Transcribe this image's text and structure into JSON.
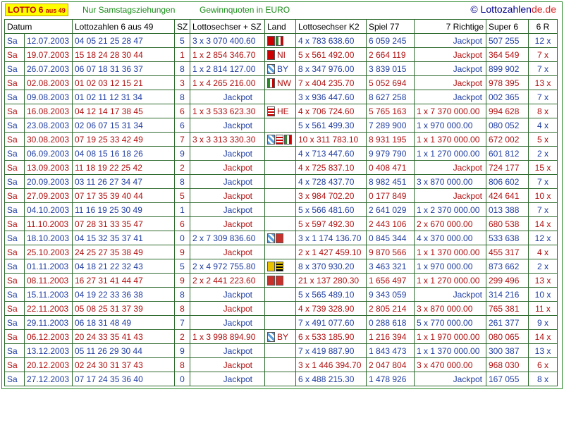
{
  "header": {
    "logo_main": "LOTTO 6",
    "logo_small": "aus 49",
    "subtitle": "Nur Samstagsziehungen",
    "currency_note": "Gewinnquoten in EURO",
    "site_prefix": "© Lottozahlen",
    "site_suffix": "de.de"
  },
  "columns": {
    "datum": "Datum",
    "zahlen": "Lottozahlen 6 aus 49",
    "sz": "SZ",
    "ls": "Lottosechser + SZ",
    "land": "Land",
    "k2": "Lottosechser K2",
    "sp77": "Spiel 77",
    "sr": "7 Richtige",
    "s6": "Super 6",
    "r6": "6 R"
  },
  "rows": [
    {
      "day": "Sa",
      "date": "12.07.2003",
      "nums": "04  05  21  25  28  47",
      "sz": "5",
      "ls": "3 x   3 070 400.60",
      "land": [
        "ni",
        "nw"
      ],
      "land_code": "",
      "k2": "4 x     783 638.60",
      "sp77": "6 059 245",
      "sr": "Jackpot",
      "s6": "507 255",
      "r6": "12 x"
    },
    {
      "day": "Sa",
      "date": "19.07.2003",
      "nums": "15  18  24  28  30  44",
      "sz": "1",
      "ls": "1 x   2 854 346.70",
      "land": [
        "ni"
      ],
      "land_code": "NI",
      "k2": "5 x     561 492.00",
      "sp77": "2 664 119",
      "sr": "Jackpot",
      "s6": "364 549",
      "r6": "7 x"
    },
    {
      "day": "Sa",
      "date": "26.07.2003",
      "nums": "06  07  18  31  36  37",
      "sz": "8",
      "ls": "1 x   2 814 127.00",
      "land": [
        "by"
      ],
      "land_code": "BY",
      "k2": "8 x     347 976.00",
      "sp77": "3 839 015",
      "sr": "Jackpot",
      "s6": "899 902",
      "r6": "7 x"
    },
    {
      "day": "Sa",
      "date": "02.08.2003",
      "nums": "01  02  03  12  15  21",
      "sz": "3",
      "ls": "1 x   4 265 216.00",
      "land": [
        "nw"
      ],
      "land_code": "NW",
      "k2": "7 x     404 235.70",
      "sp77": "5 052 694",
      "sr": "Jackpot",
      "s6": "978 395",
      "r6": "13 x"
    },
    {
      "day": "Sa",
      "date": "09.08.2003",
      "nums": "01  02  11  12  31  34",
      "sz": "8",
      "ls": "Jackpot",
      "land": [],
      "land_code": "",
      "k2": "3 x     936 447.60",
      "sp77": "8 627 258",
      "sr": "Jackpot",
      "s6": "002 365",
      "r6": "7 x"
    },
    {
      "day": "Sa",
      "date": "16.08.2003",
      "nums": "04  12  14  17  38  45",
      "sz": "6",
      "ls": "1 x   3 533 623.30",
      "land": [
        "he"
      ],
      "land_code": "HE",
      "k2": "4 x     706 724.60",
      "sp77": "5 765 163",
      "sr": "1 x 7 370 000.00",
      "s6": "994 628",
      "r6": "8 x"
    },
    {
      "day": "Sa",
      "date": "23.08.2003",
      "nums": "02  06  07  15  31  34",
      "sz": "6",
      "ls": "Jackpot",
      "land": [],
      "land_code": "",
      "k2": "5 x     561 499.30",
      "sp77": "7 289 900",
      "sr": "1 x     970 000.00",
      "s6": "080 052",
      "r6": "4 x"
    },
    {
      "day": "Sa",
      "date": "30.08.2003",
      "nums": "07  19  25  33  42  49",
      "sz": "7",
      "ls": "3 x   3 313 330.30",
      "land": [
        "by",
        "he",
        "nw"
      ],
      "land_code": "",
      "k2": "10 x   311 783.10",
      "sp77": "8 931 195",
      "sr": "1 x 1 370 000.00",
      "s6": "672 002",
      "r6": "5 x"
    },
    {
      "day": "Sa",
      "date": "06.09.2003",
      "nums": "04  08  15  16  18  26",
      "sz": "9",
      "ls": "Jackpot",
      "land": [],
      "land_code": "",
      "k2": "4 x     713 447.60",
      "sp77": "9 979 790",
      "sr": "1 x 1 270 000.00",
      "s6": "601 812",
      "r6": "2 x"
    },
    {
      "day": "Sa",
      "date": "13.09.2003",
      "nums": "11  18  19  22  25  42",
      "sz": "2",
      "ls": "Jackpot",
      "land": [],
      "land_code": "",
      "k2": "4 x     725 837.10",
      "sp77": "0 408 471",
      "sr": "Jackpot",
      "s6": "724 177",
      "r6": "15 x"
    },
    {
      "day": "Sa",
      "date": "20.09.2003",
      "nums": "03  11  26  27  34  47",
      "sz": "8",
      "ls": "Jackpot",
      "land": [],
      "land_code": "",
      "k2": "4 x     728 437.70",
      "sp77": "8 982 451",
      "sr": "3 x     870 000.00",
      "s6": "806 602",
      "r6": "7 x"
    },
    {
      "day": "Sa",
      "date": "27.09.2003",
      "nums": "07  17  35  39  40  44",
      "sz": "5",
      "ls": "Jackpot",
      "land": [],
      "land_code": "",
      "k2": "3 x     984 702.20",
      "sp77": "0 177 849",
      "sr": "Jackpot",
      "s6": "424 641",
      "r6": "10 x"
    },
    {
      "day": "Sa",
      "date": "04.10.2003",
      "nums": "11  16  19  25  30  49",
      "sz": "1",
      "ls": "Jackpot",
      "land": [],
      "land_code": "",
      "k2": "5 x     566 481.60",
      "sp77": "2 641 029",
      "sr": "1 x 2 370 000.00",
      "s6": "013 388",
      "r6": "7 x"
    },
    {
      "day": "Sa",
      "date": "11.10.2003",
      "nums": "07  28  31  33  35  47",
      "sz": "6",
      "ls": "Jackpot",
      "land": [],
      "land_code": "",
      "k2": "5 x     597 492.30",
      "sp77": "2 443 106",
      "sr": "2 x     670 000.00",
      "s6": "680 538",
      "r6": "14 x"
    },
    {
      "day": "Sa",
      "date": "18.10.2003",
      "nums": "04  15  32  35  37  41",
      "sz": "0",
      "ls": "2 x   7 309 836.60",
      "land": [
        "by",
        "rp"
      ],
      "land_code": "",
      "k2": "3 x 1 174 136.70",
      "sp77": "0 845 344",
      "sr": "4 x     370 000.00",
      "s6": "533 638",
      "r6": "12 x"
    },
    {
      "day": "Sa",
      "date": "25.10.2003",
      "nums": "24  25  27  35  38  49",
      "sz": "9",
      "ls": "Jackpot",
      "land": [],
      "land_code": "",
      "k2": "2 x 1 427 459.10",
      "sp77": "9 870 566",
      "sr": "1 x 1 370 000.00",
      "s6": "455 317",
      "r6": "4 x"
    },
    {
      "day": "Sa",
      "date": "01.11.2003",
      "nums": "04  18  21  22  32  43",
      "sz": "5",
      "ls": "2 x   4 972 755.80",
      "land": [
        "bw",
        "sn"
      ],
      "land_code": "",
      "k2": "8 x     370 930.20",
      "sp77": "3 463 321",
      "sr": "1 x     970 000.00",
      "s6": "873 662",
      "r6": "2 x"
    },
    {
      "day": "Sa",
      "date": "08.11.2003",
      "nums": "16  27  31  41  44  47",
      "sz": "9",
      "ls": "2 x   2 441 223.60",
      "land": [
        "rp",
        "rp"
      ],
      "land_code": "",
      "k2": "21 x   137 280.30",
      "sp77": "1 656 497",
      "sr": "1 x 1 270 000.00",
      "s6": "299 496",
      "r6": "13 x"
    },
    {
      "day": "Sa",
      "date": "15.11.2003",
      "nums": "04  19  22  33  36  38",
      "sz": "8",
      "ls": "Jackpot",
      "land": [],
      "land_code": "",
      "k2": "5 x     565 489.10",
      "sp77": "9 343 059",
      "sr": "Jackpot",
      "s6": "314 216",
      "r6": "10 x"
    },
    {
      "day": "Sa",
      "date": "22.11.2003",
      "nums": "05  08  25  31  37  39",
      "sz": "8",
      "ls": "Jackpot",
      "land": [],
      "land_code": "",
      "k2": "4 x     739 328.90",
      "sp77": "2 805 214",
      "sr": "3 x     870 000.00",
      "s6": "765 381",
      "r6": "11 x"
    },
    {
      "day": "Sa",
      "date": "29.11.2003",
      "nums": "06  18  31  48  49",
      "sz": "7",
      "ls": "Jackpot",
      "land": [],
      "land_code": "",
      "k2": "7 x     491 077.60",
      "sp77": "0 288 618",
      "sr": "5 x     770 000.00",
      "s6": "261 377",
      "r6": "9 x"
    },
    {
      "day": "Sa",
      "date": "06.12.2003",
      "nums": "20  24  33  35  41  43",
      "sz": "2",
      "ls": "1 x   3 998 894.90",
      "land": [
        "by"
      ],
      "land_code": "BY",
      "k2": "6 x     533 185.90",
      "sp77": "1 216 394",
      "sr": "1 x 1 970 000.00",
      "s6": "080 065",
      "r6": "14 x"
    },
    {
      "day": "Sa",
      "date": "13.12.2003",
      "nums": "05  11  26  29  30  44",
      "sz": "9",
      "ls": "Jackpot",
      "land": [],
      "land_code": "",
      "k2": "7 x     419 887.90",
      "sp77": "1 843 473",
      "sr": "1 x 1 370 000.00",
      "s6": "300 387",
      "r6": "13 x"
    },
    {
      "day": "Sa",
      "date": "20.12.2003",
      "nums": "02  24  30  31  37  43",
      "sz": "8",
      "ls": "Jackpot",
      "land": [],
      "land_code": "",
      "k2": "3 x 1 446 394.70",
      "sp77": "2 047 804",
      "sr": "3 x     470 000.00",
      "s6": "968 030",
      "r6": "6 x"
    },
    {
      "day": "Sa",
      "date": "27.12.2003",
      "nums": "07  17  24  35  36  40",
      "sz": "0",
      "ls": "Jackpot",
      "land": [],
      "land_code": "",
      "k2": "6 x     488 215.30",
      "sp77": "1 478 926",
      "sr": "Jackpot",
      "s6": "167 055",
      "r6": "8 x"
    }
  ]
}
